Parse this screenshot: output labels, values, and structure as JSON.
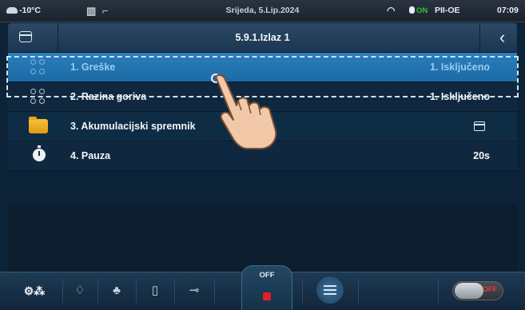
{
  "status_bar": {
    "temperature": "-10°C",
    "date": "Srijeda, 5.Lip.2024",
    "on_badge": "ON",
    "region": "PII-OE",
    "time": "07:09"
  },
  "header": {
    "title": "5.9.1.Izlaz 1"
  },
  "menu_items": [
    {
      "label": "1. Greške",
      "value": "1. Isključeno",
      "icon": "status-dots-icon",
      "selected": true
    },
    {
      "label": "2. Razina goriva",
      "value": "1. Isključeno",
      "icon": "status-dots-icon"
    },
    {
      "label": "3. Akumulacijski spremnik",
      "value": "",
      "icon": "folder-icon"
    },
    {
      "label": "4. Pauza",
      "value": "20s",
      "icon": "timer-icon"
    }
  ],
  "bottom_bar": {
    "off_label": "OFF",
    "toggle_label": "OFF"
  },
  "colors": {
    "selected_row": "#1c6aa5",
    "row_bg": "#0f2c45",
    "off_red": "#e0202a"
  }
}
